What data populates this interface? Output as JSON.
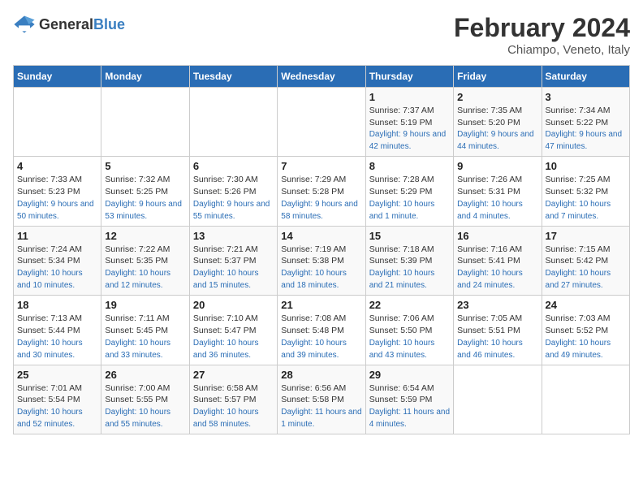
{
  "header": {
    "logo": {
      "general": "General",
      "blue": "Blue"
    },
    "title": "February 2024",
    "subtitle": "Chiampo, Veneto, Italy"
  },
  "calendar": {
    "days_of_week": [
      "Sunday",
      "Monday",
      "Tuesday",
      "Wednesday",
      "Thursday",
      "Friday",
      "Saturday"
    ],
    "weeks": [
      [
        {
          "day": null
        },
        {
          "day": null
        },
        {
          "day": null
        },
        {
          "day": null
        },
        {
          "day": "1",
          "sunrise": "7:37 AM",
          "sunset": "5:19 PM",
          "daylight": "9 hours and 42 minutes."
        },
        {
          "day": "2",
          "sunrise": "7:35 AM",
          "sunset": "5:20 PM",
          "daylight": "9 hours and 44 minutes."
        },
        {
          "day": "3",
          "sunrise": "7:34 AM",
          "sunset": "5:22 PM",
          "daylight": "9 hours and 47 minutes."
        }
      ],
      [
        {
          "day": "4",
          "sunrise": "7:33 AM",
          "sunset": "5:23 PM",
          "daylight": "9 hours and 50 minutes."
        },
        {
          "day": "5",
          "sunrise": "7:32 AM",
          "sunset": "5:25 PM",
          "daylight": "9 hours and 53 minutes."
        },
        {
          "day": "6",
          "sunrise": "7:30 AM",
          "sunset": "5:26 PM",
          "daylight": "9 hours and 55 minutes."
        },
        {
          "day": "7",
          "sunrise": "7:29 AM",
          "sunset": "5:28 PM",
          "daylight": "9 hours and 58 minutes."
        },
        {
          "day": "8",
          "sunrise": "7:28 AM",
          "sunset": "5:29 PM",
          "daylight": "10 hours and 1 minute."
        },
        {
          "day": "9",
          "sunrise": "7:26 AM",
          "sunset": "5:31 PM",
          "daylight": "10 hours and 4 minutes."
        },
        {
          "day": "10",
          "sunrise": "7:25 AM",
          "sunset": "5:32 PM",
          "daylight": "10 hours and 7 minutes."
        }
      ],
      [
        {
          "day": "11",
          "sunrise": "7:24 AM",
          "sunset": "5:34 PM",
          "daylight": "10 hours and 10 minutes."
        },
        {
          "day": "12",
          "sunrise": "7:22 AM",
          "sunset": "5:35 PM",
          "daylight": "10 hours and 12 minutes."
        },
        {
          "day": "13",
          "sunrise": "7:21 AM",
          "sunset": "5:37 PM",
          "daylight": "10 hours and 15 minutes."
        },
        {
          "day": "14",
          "sunrise": "7:19 AM",
          "sunset": "5:38 PM",
          "daylight": "10 hours and 18 minutes."
        },
        {
          "day": "15",
          "sunrise": "7:18 AM",
          "sunset": "5:39 PM",
          "daylight": "10 hours and 21 minutes."
        },
        {
          "day": "16",
          "sunrise": "7:16 AM",
          "sunset": "5:41 PM",
          "daylight": "10 hours and 24 minutes."
        },
        {
          "day": "17",
          "sunrise": "7:15 AM",
          "sunset": "5:42 PM",
          "daylight": "10 hours and 27 minutes."
        }
      ],
      [
        {
          "day": "18",
          "sunrise": "7:13 AM",
          "sunset": "5:44 PM",
          "daylight": "10 hours and 30 minutes."
        },
        {
          "day": "19",
          "sunrise": "7:11 AM",
          "sunset": "5:45 PM",
          "daylight": "10 hours and 33 minutes."
        },
        {
          "day": "20",
          "sunrise": "7:10 AM",
          "sunset": "5:47 PM",
          "daylight": "10 hours and 36 minutes."
        },
        {
          "day": "21",
          "sunrise": "7:08 AM",
          "sunset": "5:48 PM",
          "daylight": "10 hours and 39 minutes."
        },
        {
          "day": "22",
          "sunrise": "7:06 AM",
          "sunset": "5:50 PM",
          "daylight": "10 hours and 43 minutes."
        },
        {
          "day": "23",
          "sunrise": "7:05 AM",
          "sunset": "5:51 PM",
          "daylight": "10 hours and 46 minutes."
        },
        {
          "day": "24",
          "sunrise": "7:03 AM",
          "sunset": "5:52 PM",
          "daylight": "10 hours and 49 minutes."
        }
      ],
      [
        {
          "day": "25",
          "sunrise": "7:01 AM",
          "sunset": "5:54 PM",
          "daylight": "10 hours and 52 minutes."
        },
        {
          "day": "26",
          "sunrise": "7:00 AM",
          "sunset": "5:55 PM",
          "daylight": "10 hours and 55 minutes."
        },
        {
          "day": "27",
          "sunrise": "6:58 AM",
          "sunset": "5:57 PM",
          "daylight": "10 hours and 58 minutes."
        },
        {
          "day": "28",
          "sunrise": "6:56 AM",
          "sunset": "5:58 PM",
          "daylight": "11 hours and 1 minute."
        },
        {
          "day": "29",
          "sunrise": "6:54 AM",
          "sunset": "5:59 PM",
          "daylight": "11 hours and 4 minutes."
        },
        {
          "day": null
        },
        {
          "day": null
        }
      ]
    ],
    "sunrise_label": "Sunrise:",
    "sunset_label": "Sunset:",
    "daylight_label": "Daylight:"
  }
}
